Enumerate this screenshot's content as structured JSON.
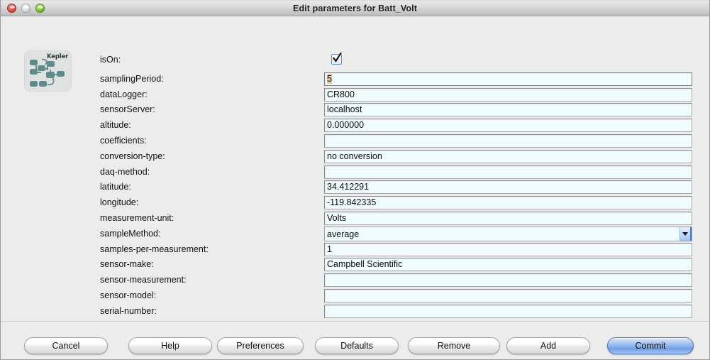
{
  "window": {
    "title": "Edit parameters for Batt_Volt",
    "traffic_lights": [
      "close-button",
      "minimize-button",
      "zoom-button"
    ]
  },
  "badge": {
    "label": "Kepler"
  },
  "form": {
    "rows": [
      {
        "label": "isOn:",
        "type": "checkbox",
        "value": "checked"
      },
      {
        "label": "samplingPeriod:",
        "type": "text",
        "value": "5",
        "focused": true,
        "selected": true
      },
      {
        "label": "dataLogger:",
        "type": "text",
        "value": "CR800"
      },
      {
        "label": "sensorServer:",
        "type": "text",
        "value": "localhost"
      },
      {
        "label": "altitude:",
        "type": "text",
        "value": "0.000000"
      },
      {
        "label": "coefficients:",
        "type": "text",
        "value": ""
      },
      {
        "label": "conversion-type:",
        "type": "text",
        "value": "no conversion"
      },
      {
        "label": "daq-method:",
        "type": "text",
        "value": ""
      },
      {
        "label": "latitude:",
        "type": "text",
        "value": "34.412291"
      },
      {
        "label": "longitude:",
        "type": "text",
        "value": "-119.842335"
      },
      {
        "label": "measurement-unit:",
        "type": "text",
        "value": "Volts"
      },
      {
        "label": "sampleMethod:",
        "type": "combo",
        "value": "average"
      },
      {
        "label": "samples-per-measurement:",
        "type": "text",
        "value": "1"
      },
      {
        "label": "sensor-make:",
        "type": "text",
        "value": "Campbell Scientific"
      },
      {
        "label": "sensor-measurement:",
        "type": "text",
        "value": ""
      },
      {
        "label": "sensor-model:",
        "type": "text",
        "value": ""
      },
      {
        "label": "serial-number:",
        "type": "text",
        "value": ""
      }
    ]
  },
  "buttons": [
    {
      "label": "Cancel",
      "name": "cancel-button",
      "default": false
    },
    {
      "label": "Help",
      "name": "help-button",
      "default": false
    },
    {
      "label": "Preferences",
      "name": "preferences-button",
      "default": false
    },
    {
      "label": "Defaults",
      "name": "defaults-button",
      "default": false
    },
    {
      "label": "Remove",
      "name": "remove-button",
      "default": false
    },
    {
      "label": "Add",
      "name": "add-button",
      "default": false
    },
    {
      "label": "Commit",
      "name": "commit-button",
      "default": true
    }
  ],
  "colors": {
    "window_background": "#ececec",
    "field_background": "#f0fbfd",
    "selection_highlight": "#f2c798",
    "default_button_accent": "#8db4ec",
    "badge_node": "#5f8b8b"
  }
}
